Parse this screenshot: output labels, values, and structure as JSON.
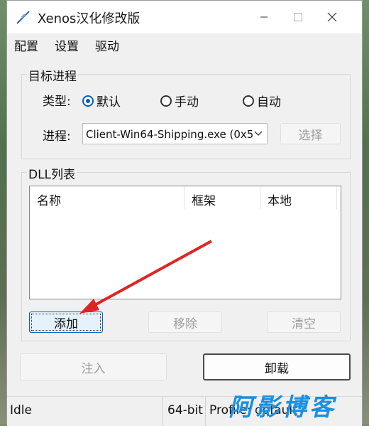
{
  "window": {
    "title": "Xenos汉化修改版"
  },
  "menu": {
    "items": [
      "配置",
      "设置",
      "驱动"
    ]
  },
  "target": {
    "group_label": "目标进程",
    "type_label": "类型:",
    "radios": [
      {
        "label": "默认",
        "checked": true
      },
      {
        "label": "手动",
        "checked": false
      },
      {
        "label": "自动",
        "checked": false
      }
    ],
    "process_label": "进程:",
    "process_value": "Client-Win64-Shipping.exe (0x5",
    "select_button": "选择"
  },
  "dll": {
    "group_label": "DLL列表",
    "columns": [
      "名称",
      "框架",
      "本地"
    ],
    "add_button": "添加",
    "remove_button": "移除",
    "clear_button": "清空"
  },
  "actions": {
    "inject_button": "注入",
    "unload_button": "卸载"
  },
  "status": {
    "state": "Idle",
    "arch": "64-bit",
    "profile": "Profile: default"
  },
  "watermark": "阿影博客",
  "colors": {
    "accent": "#005fb8",
    "arrow": "#e02424",
    "watermark": "#1a8fe0"
  }
}
